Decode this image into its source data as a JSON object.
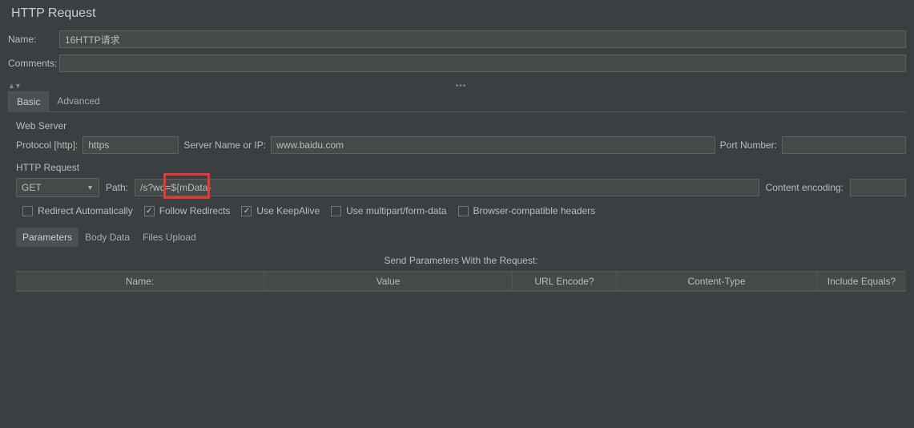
{
  "title": "HTTP Request",
  "form": {
    "name_label": "Name:",
    "name_value": "16HTTP请求",
    "comments_label": "Comments:",
    "comments_value": ""
  },
  "tabs": {
    "basic": "Basic",
    "advanced": "Advanced"
  },
  "webserver": {
    "section_label": "Web Server",
    "protocol_label": "Protocol [http]:",
    "protocol_value": "https",
    "server_label": "Server Name or IP:",
    "server_value": "www.baidu.com",
    "port_label": "Port Number:",
    "port_value": ""
  },
  "http": {
    "section_label": "HTTP Request",
    "method": "GET",
    "path_label": "Path:",
    "path_value": "/s?wd=${mData}",
    "encoding_label": "Content encoding:",
    "encoding_value": ""
  },
  "checks": {
    "redirect_auto": "Redirect Automatically",
    "follow_redirects": "Follow Redirects",
    "keepalive": "Use KeepAlive",
    "multipart": "Use multipart/form-data",
    "browser_compat": "Browser-compatible headers"
  },
  "subtabs": {
    "parameters": "Parameters",
    "body": "Body Data",
    "files": "Files Upload"
  },
  "params": {
    "title": "Send Parameters With the Request:",
    "headers": {
      "name": "Name:",
      "value": "Value",
      "encode": "URL Encode?",
      "ctype": "Content-Type",
      "equals": "Include Equals?"
    }
  }
}
